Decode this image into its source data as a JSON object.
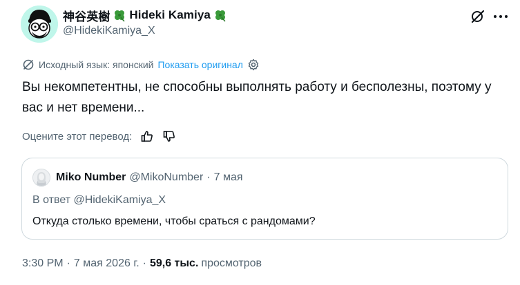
{
  "author": {
    "display_name": "神谷英樹",
    "display_name_latin": "Hideki Kamiya",
    "handle": "@HidekiKamiya_X",
    "clover_icon": "four-leaf-clover-emoji"
  },
  "header_actions": {
    "grok_icon": "grok-icon",
    "more_icon": "more-dots-icon"
  },
  "translation": {
    "source_label": "Исходный язык: японский",
    "show_original_label": "Показать оригинал",
    "icon": "translate-icon",
    "settings_icon": "gear-icon"
  },
  "tweet": {
    "text": "Вы некомпетентны, не способны выполнять работу и бесполезны, поэтому у вас и нет времени..."
  },
  "rate": {
    "label": "Оцените этот перевод:",
    "thumbs_up_icon": "thumbs-up-icon",
    "thumbs_down_icon": "thumbs-down-icon"
  },
  "quote": {
    "name": "Miko Number",
    "handle": "@MikoNumber",
    "separator": "·",
    "time": "7 мая",
    "reply_to": "В ответ @HidekiKamiya_X",
    "text": "Откуда столько времени, чтобы сраться с рандомами?"
  },
  "meta": {
    "time": "3:30 PM",
    "separator": "·",
    "date": "7 мая 2026 г.",
    "views_count": "59,6 тыс.",
    "views_label": "просмотров"
  },
  "colors": {
    "link": "#1d9bf0",
    "secondary_text": "#536471",
    "border": "#cfd9de"
  }
}
